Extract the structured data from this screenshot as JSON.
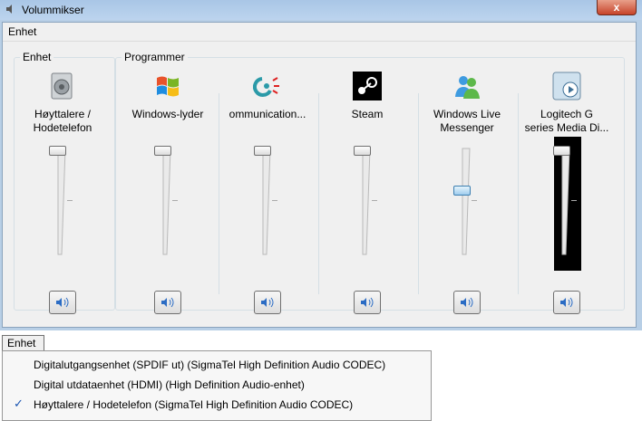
{
  "window": {
    "title": "Volummikser",
    "close_label": "x"
  },
  "menu": {
    "enhet_label": "Enhet"
  },
  "groups": {
    "device_label": "Enhet",
    "apps_label": "Programmer"
  },
  "channels": [
    {
      "name_line1": "Høyttalere /",
      "name_line2": "Hodetelefon",
      "icon": "speaker-icon",
      "level": 1.0,
      "muted": false
    },
    {
      "name_line1": "Windows-lyder",
      "name_line2": "",
      "icon": "windows-logo-icon",
      "level": 1.0,
      "muted": false
    },
    {
      "name_line1": "",
      "name_line2": "ommunication...",
      "icon": "logitech-icon",
      "level": 1.0,
      "muted": false
    },
    {
      "name_line1": "Steam",
      "name_line2": "",
      "icon": "steam-icon",
      "level": 1.0,
      "muted": false
    },
    {
      "name_line1": "Windows Live",
      "name_line2": "Messenger",
      "icon": "messenger-icon",
      "level": 0.6,
      "muted": false
    },
    {
      "name_line1": "Logitech G",
      "name_line2": "series Media Di...",
      "icon": "media-display-icon",
      "level": 1.0,
      "muted": false
    }
  ],
  "device_dropdown": {
    "label": "Enhet",
    "items": [
      {
        "label": "Digitalutgangsenhet (SPDIF ut) (SigmaTel High Definition Audio CODEC)",
        "checked": false
      },
      {
        "label": "Digital utdataenhet (HDMI) (High Definition Audio-enhet)",
        "checked": false
      },
      {
        "label": "Høyttalere / Hodetelefon (SigmaTel High Definition Audio CODEC)",
        "checked": true
      }
    ],
    "check_glyph": "✓"
  }
}
